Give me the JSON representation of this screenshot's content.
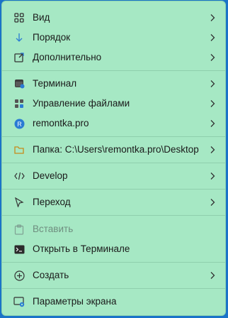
{
  "menu": {
    "items": [
      {
        "label": "Вид",
        "icon": "grid-icon"
      },
      {
        "label": "Порядок",
        "icon": "sort-arrow-icon"
      },
      {
        "label": "Дополнительно",
        "icon": "external-link-icon"
      },
      {
        "label": "Терминал",
        "icon": "terminal-icon"
      },
      {
        "label": "Управление файлами",
        "icon": "apps-grid-icon"
      },
      {
        "label": "remontka.pro",
        "icon": "avatar-icon",
        "avatar_letter": "R"
      },
      {
        "label": "Папка: C:\\Users\\remontka.pro\\Desktop",
        "icon": "folder-icon"
      },
      {
        "label": "Develop",
        "icon": "code-icon"
      },
      {
        "label": "Переход",
        "icon": "cursor-icon"
      },
      {
        "label": "Вставить",
        "icon": "paste-icon",
        "disabled": true
      },
      {
        "label": "Открыть в Терминале",
        "icon": "terminal-prompt-icon"
      },
      {
        "label": "Создать",
        "icon": "plus-circle-icon"
      },
      {
        "label": "Параметры экрана",
        "icon": "display-settings-icon"
      }
    ]
  },
  "colors": {
    "menu_background": "#a6e8c4",
    "separator": "#8fcfad",
    "accent_blue": "#1a73c8",
    "text": "#1a1a1a",
    "disabled_text": "#6f8e7f"
  }
}
